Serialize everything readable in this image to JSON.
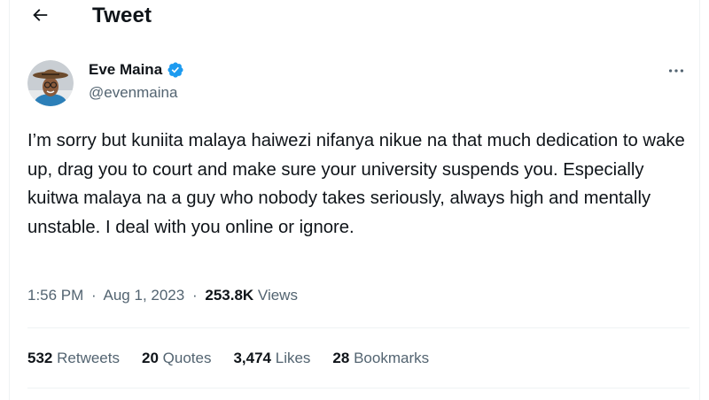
{
  "header": {
    "back_icon": "arrow-left-icon",
    "title": "Tweet"
  },
  "author": {
    "name": "Eve Maina",
    "handle": "@evenmaina",
    "verified_icon": "verified-badge-icon",
    "verified_color": "#1d9bf0"
  },
  "more_icon": "more-horizontal-icon",
  "tweet": {
    "text": "I’m sorry but kuniita malaya haiwezi nifanya nikue na that much dedication to wake up, drag you to court and make sure your university suspends you. Especially kuitwa malaya na a guy who nobody takes seriously, always high and mentally unstable. I deal with you online or ignore."
  },
  "meta": {
    "time": "1:56 PM",
    "separator": "·",
    "date": "Aug 1, 2023",
    "views_count": "253.8K",
    "views_label": "Views"
  },
  "stats": [
    {
      "count": "532",
      "label": "Retweets"
    },
    {
      "count": "20",
      "label": "Quotes"
    },
    {
      "count": "3,474",
      "label": "Likes"
    },
    {
      "count": "28",
      "label": "Bookmarks"
    }
  ],
  "colors": {
    "text": "#0f1419",
    "secondary": "#536471",
    "divider": "#eff3f4"
  }
}
